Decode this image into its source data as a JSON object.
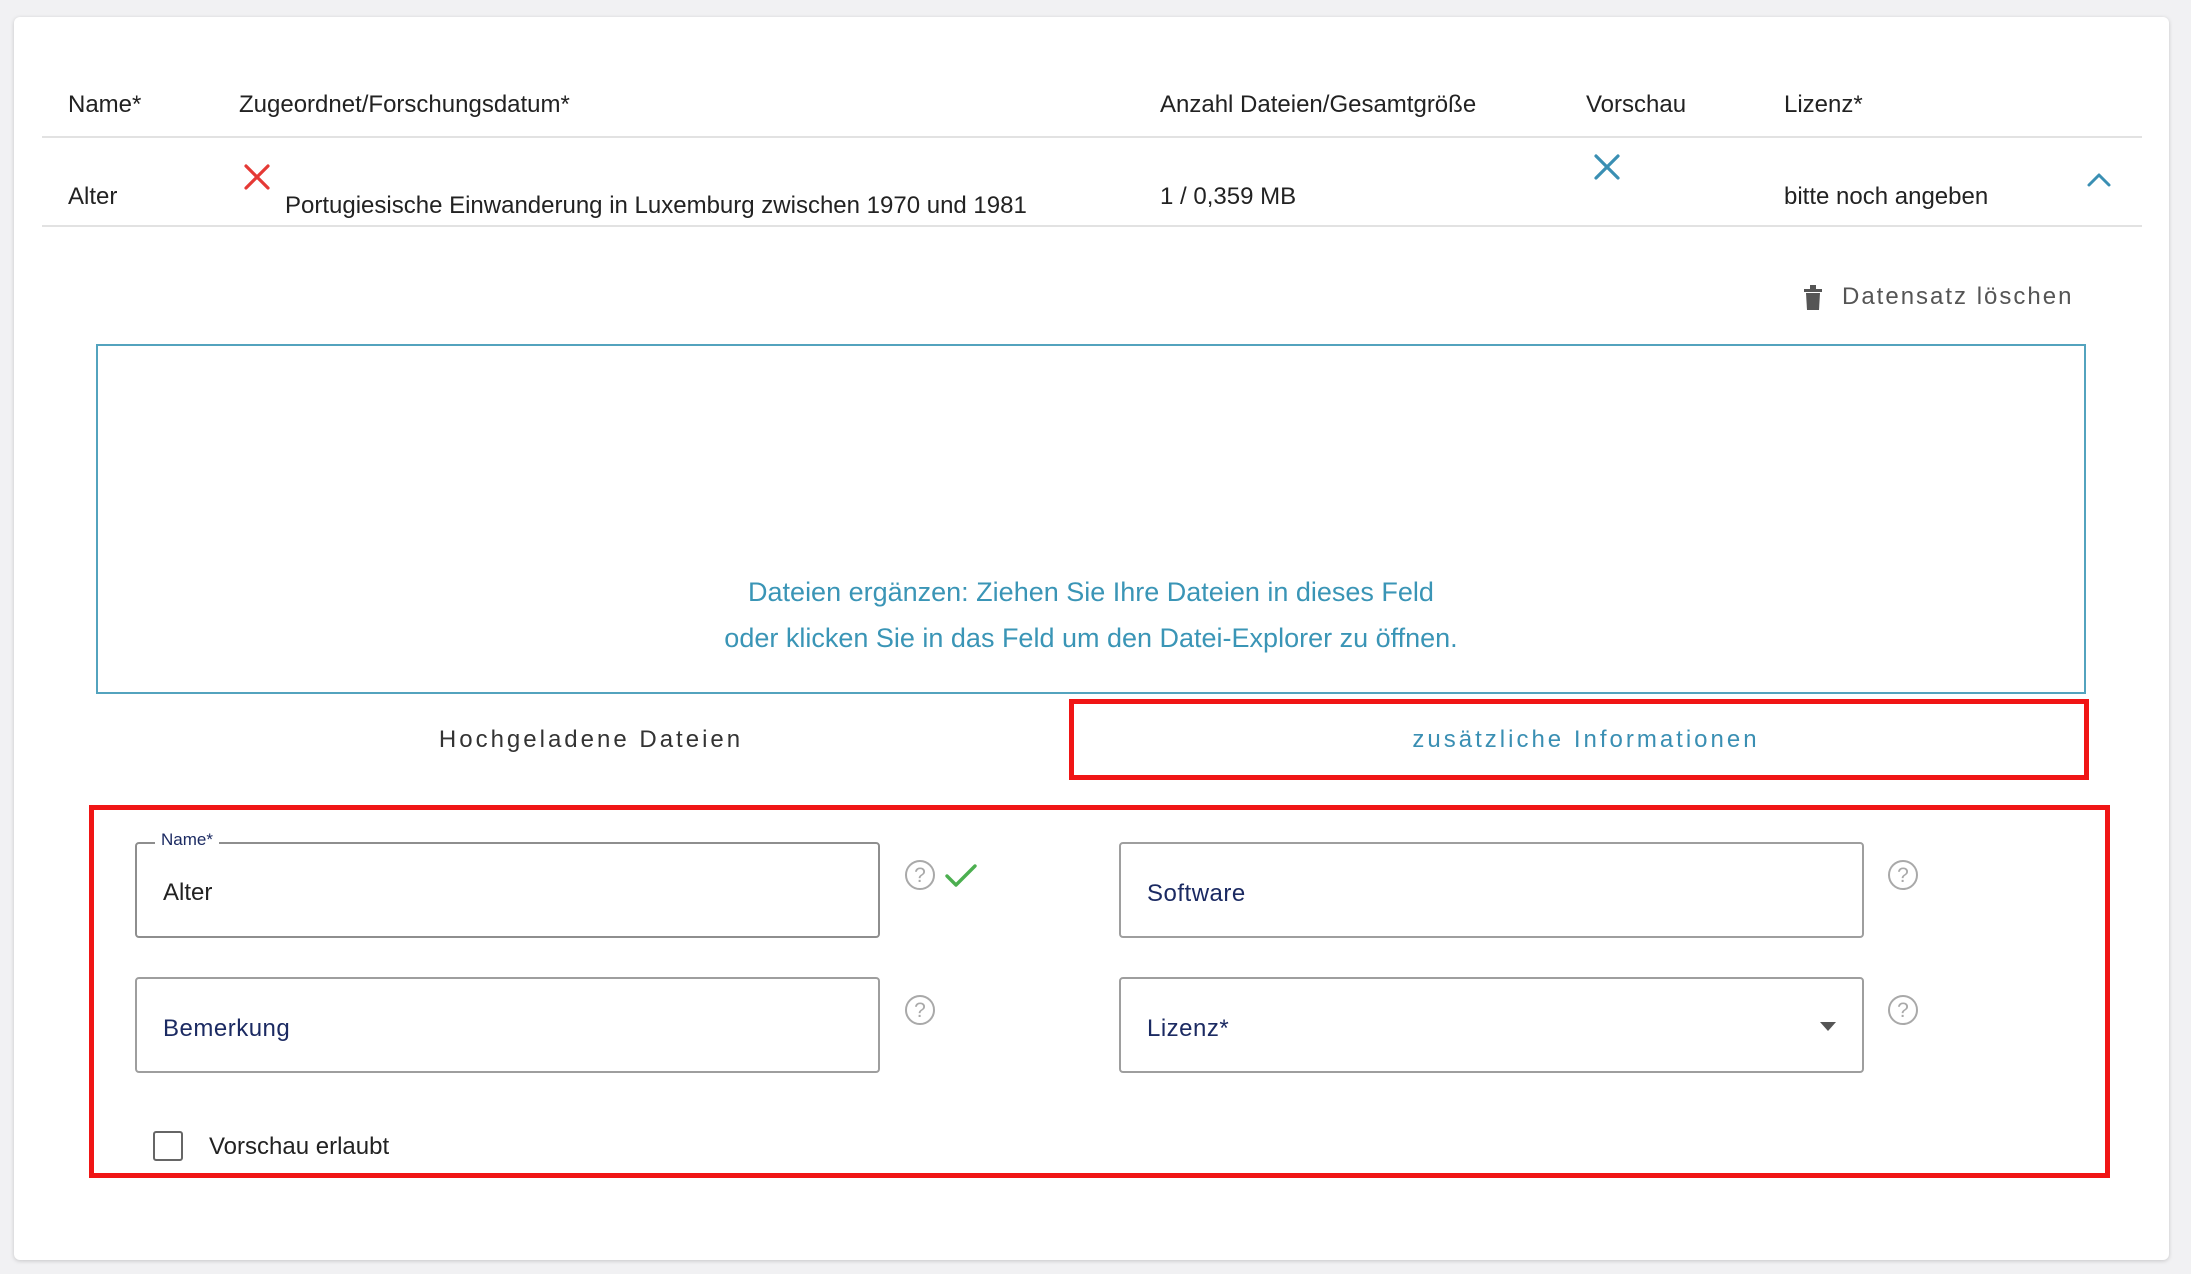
{
  "table": {
    "headers": {
      "name": "Name*",
      "assigned": "Zugeordnet/Forschungsdatum*",
      "files": "Anzahl Dateien/Gesamtgröße",
      "preview": "Vorschau",
      "license": "Lizenz*"
    },
    "row": {
      "name": "Alter",
      "assigned": "Portugiesische Einwanderung in Luxemburg zwischen 1970 und 1981",
      "files": "1 / 0,359 MB",
      "license": "bitte noch angeben"
    }
  },
  "actions": {
    "delete_label": "Datensatz löschen"
  },
  "dropzone": {
    "line1": "Dateien ergänzen: Ziehen Sie Ihre Dateien in dieses Feld",
    "line2": "oder klicken Sie in das Feld um den Datei-Explorer zu öffnen."
  },
  "tabs": {
    "uploaded": "Hochgeladene Dateien",
    "additional": "zusätzliche Informationen"
  },
  "form": {
    "name_label": "Name",
    "name_required": "*",
    "name_value": "Alter",
    "software_label": "Software",
    "remark_label": "Bemerkung",
    "license_label": "Lizenz",
    "license_required": "*",
    "preview_checkbox_label": "Vorschau erlaubt",
    "help_glyph": "?"
  },
  "colors": {
    "accent": "#3a8fb3",
    "error": "#e53935",
    "success": "#4caf50",
    "highlight": "#f01515",
    "label": "#1b2a62"
  }
}
